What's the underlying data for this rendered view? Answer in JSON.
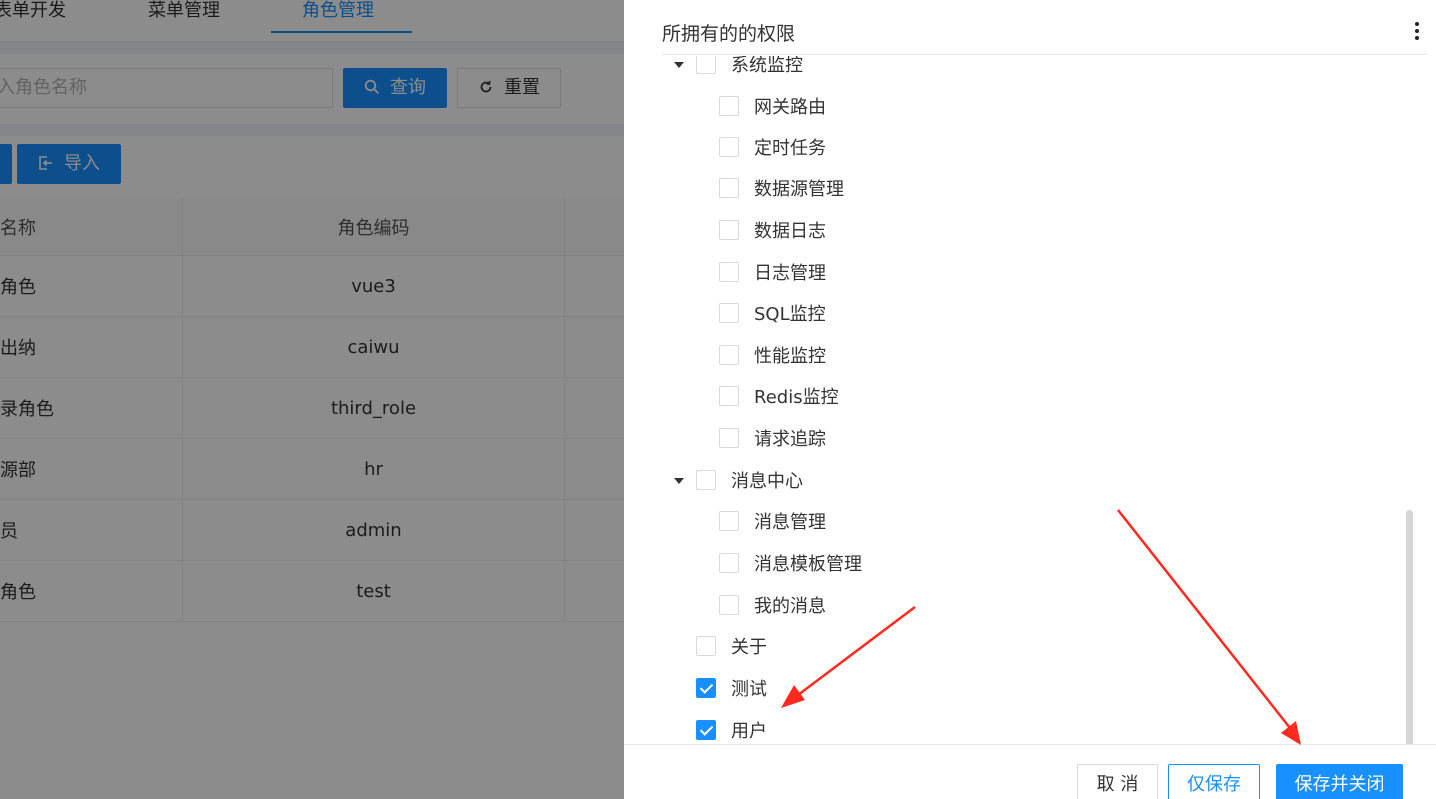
{
  "tabs": [
    {
      "label": "表单开发"
    },
    {
      "label": "菜单管理"
    },
    {
      "label": "角色管理"
    }
  ],
  "search": {
    "placeholder": "入角色名称",
    "query_label": "查询",
    "reset_label": "重置"
  },
  "toolbar": {
    "import_label": "导入"
  },
  "table": {
    "headers": [
      "名称",
      "角色编码"
    ],
    "rows": [
      {
        "name": "角色",
        "code": "vue3"
      },
      {
        "name": "出纳",
        "code": "caiwu"
      },
      {
        "name": "录角色",
        "code": "third_role"
      },
      {
        "name": "源部",
        "code": "hr"
      },
      {
        "name": "员",
        "code": "admin"
      },
      {
        "name": "角色",
        "code": "test"
      }
    ]
  },
  "drawer": {
    "title": "所拥有的的权限",
    "tree": [
      {
        "label": "系统监控",
        "checked": false,
        "expanded": true
      },
      {
        "label": "网关路由",
        "checked": false
      },
      {
        "label": "定时任务",
        "checked": false
      },
      {
        "label": "数据源管理",
        "checked": false
      },
      {
        "label": "数据日志",
        "checked": false
      },
      {
        "label": "日志管理",
        "checked": false
      },
      {
        "label": "SQL监控",
        "checked": false
      },
      {
        "label": "性能监控",
        "checked": false
      },
      {
        "label": "Redis监控",
        "checked": false
      },
      {
        "label": "请求追踪",
        "checked": false
      },
      {
        "label": "消息中心",
        "checked": false,
        "expanded": true
      },
      {
        "label": "消息管理",
        "checked": false
      },
      {
        "label": "消息模板管理",
        "checked": false
      },
      {
        "label": "我的消息",
        "checked": false
      },
      {
        "label": "关于",
        "checked": false
      },
      {
        "label": "测试",
        "checked": true
      },
      {
        "label": "用户",
        "checked": true
      }
    ],
    "footer": {
      "cancel_label": "取 消",
      "save_label": "仅保存",
      "save_close_label": "保存并关闭"
    }
  },
  "colors": {
    "primary": "#1890ff",
    "annotation_arrow": "#ff2a1f"
  }
}
